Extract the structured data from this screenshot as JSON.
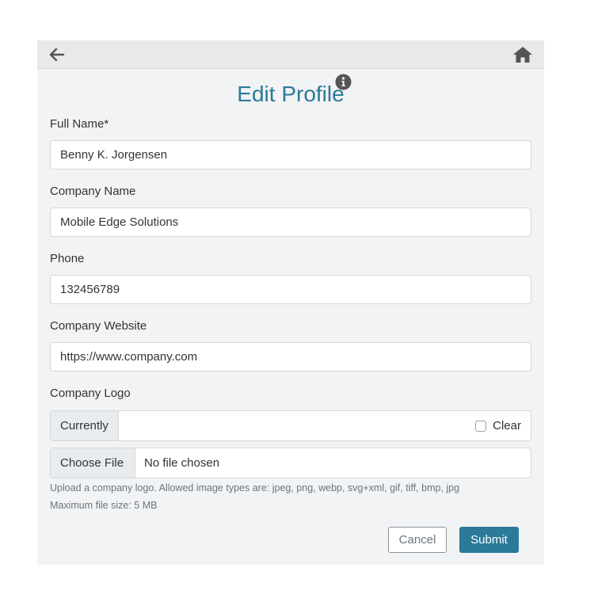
{
  "colors": {
    "accent": "#2b7a99",
    "card_bg": "#f2f3f4",
    "topbar_bg": "#e8e9ea"
  },
  "topbar": {
    "back_icon": "arrow-left-icon",
    "home_icon": "home-icon"
  },
  "page": {
    "title": "Edit Profile",
    "info_icon": "info-icon"
  },
  "form": {
    "full_name": {
      "label": "Full Name*",
      "value": "Benny K. Jorgensen"
    },
    "company_name": {
      "label": "Company Name",
      "value": "Mobile Edge Solutions"
    },
    "phone": {
      "label": "Phone",
      "value": "132456789"
    },
    "company_website": {
      "label": "Company Website",
      "value": "https://www.company.com"
    },
    "company_logo": {
      "label": "Company Logo",
      "currently_label": "Currently",
      "clear_label": "Clear",
      "choose_file_label": "Choose File",
      "file_status": "No file chosen",
      "help_line1": "Upload a company logo. Allowed image types are: jpeg, png, webp, svg+xml, gif, tiff, bmp, jpg",
      "help_line2": "Maximum file size: 5 MB"
    }
  },
  "actions": {
    "cancel_label": "Cancel",
    "submit_label": "Submit"
  }
}
